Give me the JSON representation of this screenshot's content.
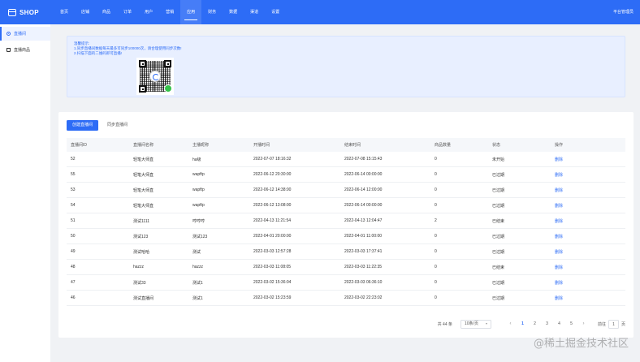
{
  "header": {
    "logo_text": "SHOP",
    "nav": [
      "首页",
      "店铺",
      "商品",
      "订单",
      "用户",
      "营销",
      "应用",
      "财务",
      "数据",
      "渠道",
      "设置"
    ],
    "active_index": 6,
    "right_text": "平台管理员"
  },
  "sidebar": {
    "items": [
      {
        "label": "直播间",
        "icon": "broadcast-icon",
        "active": true
      },
      {
        "label": "直播商品",
        "icon": "shopping-bag-icon",
        "active": false
      }
    ]
  },
  "notice": {
    "title": "温馨提示:",
    "line1": "1.同步直播间数据每天最多可同步100000次，请合理使用同步次数!",
    "line2": "2.扫描下面的二维码即可直播!"
  },
  "tabs": {
    "create_label": "创建直播间",
    "sync_label": "同步直播间"
  },
  "table": {
    "headers": [
      "直播间ID",
      "直播间名称",
      "主播昵称",
      "开播时间",
      "结束时间",
      "商品数量",
      "状态",
      "操作"
    ],
    "rows": [
      [
        "52",
        "轻笔大师直",
        "ha级",
        "2022-07-07 18:16:32",
        "2022-07-08 15:15:43",
        "0",
        "未开始",
        "删除"
      ],
      [
        "55",
        "轻笔大师直",
        "wapftp",
        "2022-06-12 20:30:00",
        "2022-06-14 00:00:00",
        "0",
        "已过期",
        "删除"
      ],
      [
        "53",
        "轻笔大师直",
        "wapftp",
        "2022-06-12 14:38:00",
        "2022-06-14 12:00:00",
        "0",
        "已过期",
        "删除"
      ],
      [
        "54",
        "轻笔大师直",
        "wapftp",
        "2022-06-12 13:08:00",
        "2022-06-14 00:00:00",
        "0",
        "已过期",
        "删除"
      ],
      [
        "51",
        "测试1111",
        "哼哼哼",
        "2022-04-13 11:21:54",
        "2022-04-13 12:04:47",
        "2",
        "已结束",
        "删除"
      ],
      [
        "50",
        "测试123",
        "测试123",
        "2022-04-01 20:00:00",
        "2022-04-01 11:00:00",
        "0",
        "已过期",
        "删除"
      ],
      [
        "49",
        "测试哈哈",
        "测试",
        "2022-03-03 12:57:28",
        "2022-03-03 17:37:41",
        "0",
        "已过期",
        "删除"
      ],
      [
        "48",
        "hazzz",
        "hazzz",
        "2022-03-03 11:08:05",
        "2022-03-03 11:22:35",
        "0",
        "已结束",
        "删除"
      ],
      [
        "47",
        "测试33",
        "测试1",
        "2022-03-02 15:36:04",
        "2022-03-03 06:36:10",
        "0",
        "已过期",
        "删除"
      ],
      [
        "46",
        "测试直播间",
        "测试1",
        "2022-03-02 15:23:59",
        "2022-03-02 22:23:02",
        "0",
        "已过期",
        "删除"
      ]
    ]
  },
  "pagination": {
    "total": "共 44 条",
    "page_size": "10条/页",
    "prev_icon": "‹",
    "pages": [
      "1",
      "2",
      "3",
      "4",
      "5"
    ],
    "current_page": "1",
    "next_icon": "›",
    "goto_label": "前往",
    "goto_value": "1",
    "goto_suffix": "页"
  },
  "watermark": "@稀土掘金技术社区",
  "colors": {
    "primary": "#2d6cf6",
    "notice_bg": "#e8efff",
    "page_bg": "#f0f2f5"
  }
}
